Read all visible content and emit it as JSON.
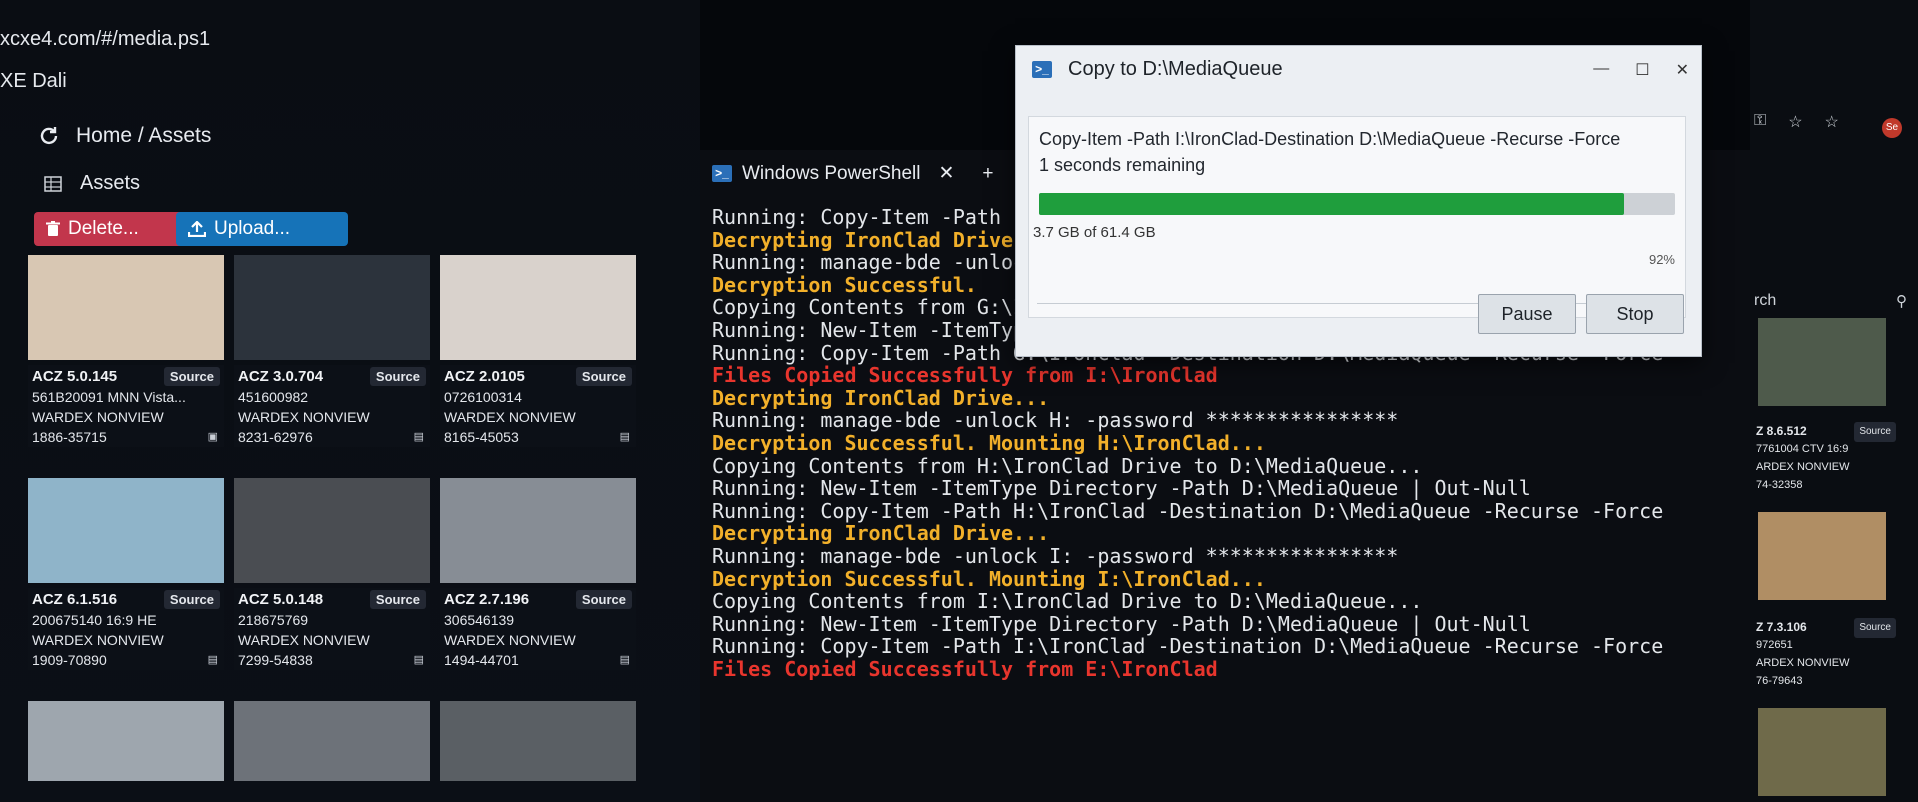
{
  "browser": {
    "url": "xcxe4.com/#/media.ps1",
    "app_name": "XE Dali"
  },
  "media": {
    "breadcrumb": "Home / Assets",
    "assets_label": "Assets",
    "delete_label": "Delete...",
    "upload_label": "Upload...",
    "source_label": "Source",
    "cards": [
      {
        "code": "ACZ 5.0.145",
        "line1": "561B20091 MNN Vista...",
        "line2": "WARDEX NONVIEW",
        "line3": "1886-35715",
        "tone": "#d8c7b3"
      },
      {
        "code": "ACZ 3.0.704",
        "line1": "451600982",
        "line2": "WARDEX NONVIEW",
        "line3": "8231-62976",
        "tone": "#2c333c"
      },
      {
        "code": "ACZ 2.0105",
        "line1": "0726100314",
        "line2": "WARDEX NONVIEW",
        "line3": "8165-45053",
        "tone": "#d9d2cc"
      },
      {
        "code": "ACZ 6.1.516",
        "line1": "200675140 16:9 HE",
        "line2": "WARDEX NONVIEW",
        "line3": "1909-70890",
        "tone": "#8fb4c9"
      },
      {
        "code": "ACZ 5.0.148",
        "line1": "218675769",
        "line2": "WARDEX NONVIEW",
        "line3": "7299-54838",
        "tone": "#4a4d52"
      },
      {
        "code": "ACZ 2.7.196",
        "line1": "306546139",
        "line2": "WARDEX NONVIEW",
        "line3": "1494-44701",
        "tone": "#878d95"
      }
    ]
  },
  "powershell": {
    "tab_title": "Windows PowerShell",
    "lines": [
      {
        "text": "Running: Copy-Item -Path",
        "kind": "run"
      },
      {
        "text": "Decrypting IronClad Drive...",
        "kind": "warn"
      },
      {
        "text": "Running: manage-bde -unlock",
        "kind": "run"
      },
      {
        "text": "Decryption Successful.",
        "kind": "warn"
      },
      {
        "text": "Copying Contents from G:\\IronClad Drive to D:\\MediaQueue...",
        "kind": "run"
      },
      {
        "text": "Running: New-Item -ItemType Directory -Path D:\\MediaQueue | Out-Null",
        "kind": "run"
      },
      {
        "text": "Running: Copy-Item -Path G:\\IronClad -Destination D:\\MediaQueue -Recurse -Force",
        "kind": "run"
      },
      {
        "text": "Files Copied Successfully from I:\\IronClad",
        "kind": "err"
      },
      {
        "text": "Decrypting IronClad Drive...",
        "kind": "warn"
      },
      {
        "text": "Running: manage-bde -unlock H: -password ****************",
        "kind": "run"
      },
      {
        "text": "Decryption Successful. Mounting H:\\IronClad...",
        "kind": "warn"
      },
      {
        "text": "Copying Contents from H:\\IronClad Drive to D:\\MediaQueue...",
        "kind": "run"
      },
      {
        "text": "Running: New-Item -ItemType Directory -Path D:\\MediaQueue | Out-Null",
        "kind": "run"
      },
      {
        "text": "Running: Copy-Item -Path H:\\IronClad -Destination D:\\MediaQueue -Recurse -Force",
        "kind": "run"
      },
      {
        "text": "Decrypting IronClad Drive...",
        "kind": "warn"
      },
      {
        "text": "Running: manage-bde -unlock I: -password ****************",
        "kind": "run"
      },
      {
        "text": "Decryption Successful. Mounting I:\\IronClad...",
        "kind": "warn"
      },
      {
        "text": "Copying Contents from I:\\IronClad Drive to D:\\MediaQueue...",
        "kind": "run"
      },
      {
        "text": "Running: New-Item -ItemType Directory -Path D:\\MediaQueue | Out-Null",
        "kind": "run"
      },
      {
        "text": "Running: Copy-Item -Path I:\\IronClad -Destination D:\\MediaQueue -Recurse -Force",
        "kind": "run"
      },
      {
        "text": "Files Copied Successfully from E:\\IronClad",
        "kind": "err"
      }
    ]
  },
  "dialog": {
    "title": "Copy to D:\\MediaQueue",
    "command": "Copy-Item -Path I:\\IronClad-Destination D:\\MediaQueue -Recurse -Force",
    "remaining": "1 seconds remaining",
    "size": "3.7 GB of 61.4 GB",
    "percent_label": "92%",
    "progress": 0.92,
    "pause_label": "Pause",
    "stop_label": "Stop"
  },
  "right_panel": {
    "search_label": "rch",
    "cards": [
      {
        "code": "Z 8.6.512",
        "line1": "7761004 CTV 16:9",
        "line2": "ARDEX NONVIEW",
        "line3": "74-32358",
        "tone": "#4e5a4b"
      },
      {
        "code": "Z 7.3.106",
        "line1": "972651",
        "line2": "ARDEX NONVIEW",
        "line3": "76-79643",
        "tone": "#b08e64"
      }
    ],
    "avatar_text": "Se"
  }
}
